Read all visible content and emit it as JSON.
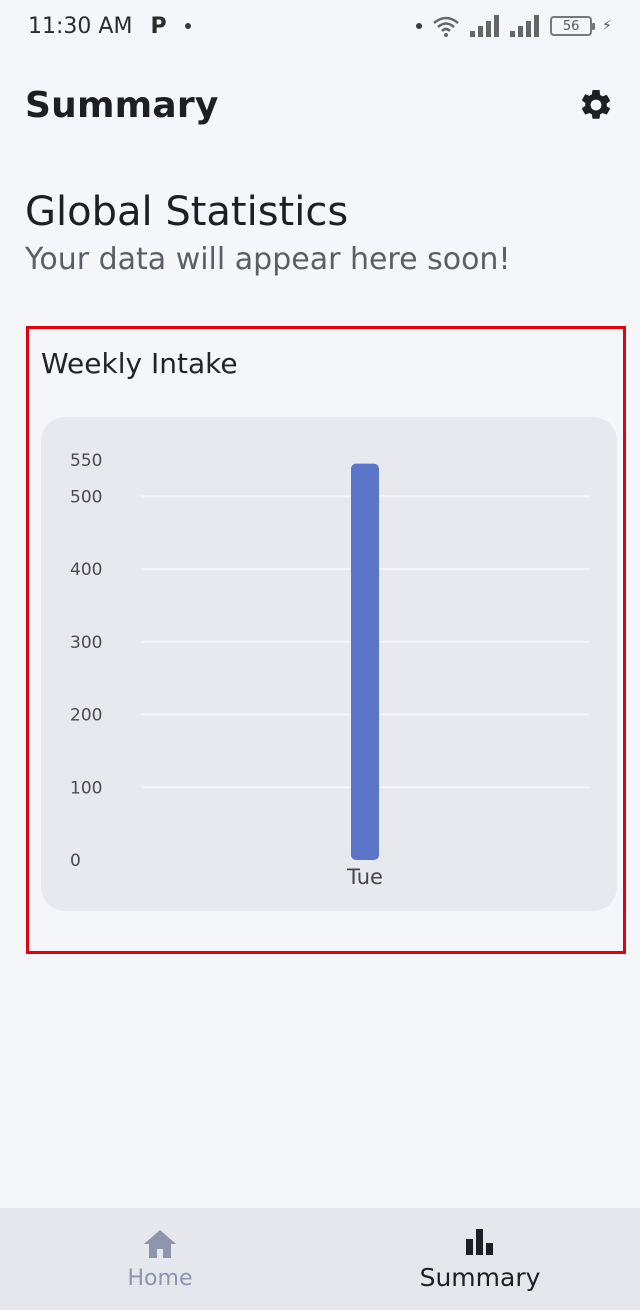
{
  "status_bar": {
    "time": "11:30 AM",
    "app_badge": "P",
    "battery_level": "56"
  },
  "header": {
    "title": "Summary",
    "settings_icon": "gear-icon"
  },
  "section": {
    "title": "Global Statistics",
    "subtitle": "Your data will appear here soon!"
  },
  "card": {
    "title": "Weekly Intake"
  },
  "chart_data": {
    "type": "bar",
    "categories": [
      "Tue"
    ],
    "values": [
      545
    ],
    "title": "Weekly Intake",
    "xlabel": "",
    "ylabel": "",
    "ylim": [
      0,
      550
    ],
    "yticks": [
      0,
      100,
      200,
      300,
      400,
      500,
      550
    ],
    "grid": true,
    "bar_color": "#5b76c8"
  },
  "bottom_nav": {
    "items": [
      {
        "label": "Home",
        "icon": "home-icon",
        "active": false
      },
      {
        "label": "Summary",
        "icon": "bar-chart-icon",
        "active": true
      }
    ]
  },
  "colors": {
    "highlight_border": "#e3000f",
    "background": "#f5f6fa",
    "chart_background": "#e8e9ee",
    "inactive_nav": "#8e95ad"
  }
}
